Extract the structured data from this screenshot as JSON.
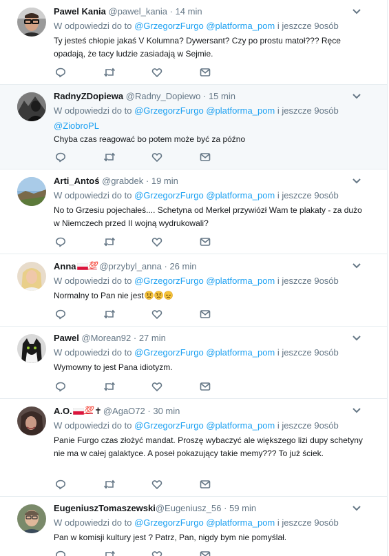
{
  "reply_prefix": "W odpowiedzi do",
  "to_word": "to",
  "mention_1": "@GrzegorzFurgo",
  "mention_2": "@platforma_pom",
  "others_suffix": "i jeszcze 9osób",
  "sep": "·",
  "colors": {
    "accent": "#1da1f2",
    "muted": "#657786",
    "text": "#14171a",
    "highlight_bg": "#f5f8fa"
  },
  "tweets": [
    {
      "name": "Pawel Kania",
      "handle": "@pawel_kania",
      "time": "14 min",
      "text": "Ty jesteś chłopie jakaś V Kolumna? Dywersant? Czy po prostu matoł??? Ręce opadają, że tacy ludzie zasiadają w Sejmie."
    },
    {
      "name": "RadnyZDopiewa",
      "handle": "@Radny_Dopiewo",
      "time": "15 min",
      "extra_mention": "@ZiobroPL",
      "text": "Chyba czas reagować bo potem może być za późno"
    },
    {
      "name": "Arti_Antoś",
      "handle": "@grabdek",
      "time": "19 min",
      "text": "No to Grzesiu pojechałeś.... Schetyna od Merkel przywiózł Wam te plakaty - za dużo w Niemczech przed II wojną wydrukowali?"
    },
    {
      "name": "Anna",
      "badge": "💯",
      "handle": "@przybyl_anna",
      "time": "26 min",
      "text": "Normalny to Pan nie jest",
      "emojis": [
        "angry-face",
        "angry-face",
        "disappointed-face"
      ]
    },
    {
      "name": "Pawel",
      "handle": "@Morean92",
      "time": "27 min",
      "text": "Wymowny to jest Pana idiotyzm."
    },
    {
      "name": "A.O.",
      "badge": "💯",
      "cross": "✝",
      "handle": "@AgaO72",
      "time": "30 min",
      "text": "Panie Furgo czas złożyć mandat. Proszę wybaczyć ale większego lizi dupy schetyny nie ma w całej galaktyce. A poseł pokazujący takie memy??? To już ściek."
    },
    {
      "name": "EugeniuszTomaszewski",
      "handle": "@Eugeniusz_56",
      "time": "59 min",
      "text": "Pan w komisji kultury jest ? Patrz, Pan, nigdy bym nie pomyślał."
    }
  ]
}
